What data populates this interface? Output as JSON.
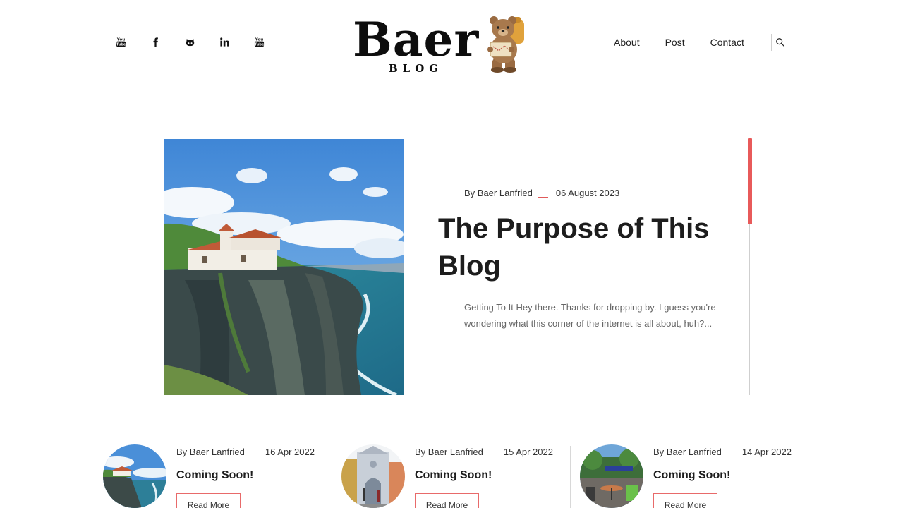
{
  "header": {
    "logo": {
      "word": "Baer",
      "sub": "BLOG"
    },
    "socials": [
      "youtube-icon",
      "facebook-icon",
      "github-icon",
      "linkedin-icon",
      "youtube-icon"
    ],
    "nav": {
      "about": "About",
      "post": "Post",
      "contact": "Contact"
    }
  },
  "featured": {
    "author": "By Baer Lanfried",
    "date": "06 August 2023",
    "title": "The Purpose of This Blog",
    "excerpt": "Getting To It Hey there. Thanks for dropping by. I guess you're wondering what this corner of the internet is all about, huh?..."
  },
  "cards": [
    {
      "author": "By Baer Lanfried",
      "date": "16 Apr 2022",
      "title": "Coming Soon!",
      "button": "Read More"
    },
    {
      "author": "By Baer Lanfried",
      "date": "15 Apr 2022",
      "title": "Coming Soon!",
      "button": "Read More"
    },
    {
      "author": "By Baer Lanfried",
      "date": "14 Apr 2022",
      "title": "Coming Soon!",
      "button": "Read More"
    }
  ],
  "colors": {
    "accent": "#e85a5a",
    "text": "#1d1d1d",
    "muted": "#666666",
    "rule": "#e2e2e2"
  }
}
